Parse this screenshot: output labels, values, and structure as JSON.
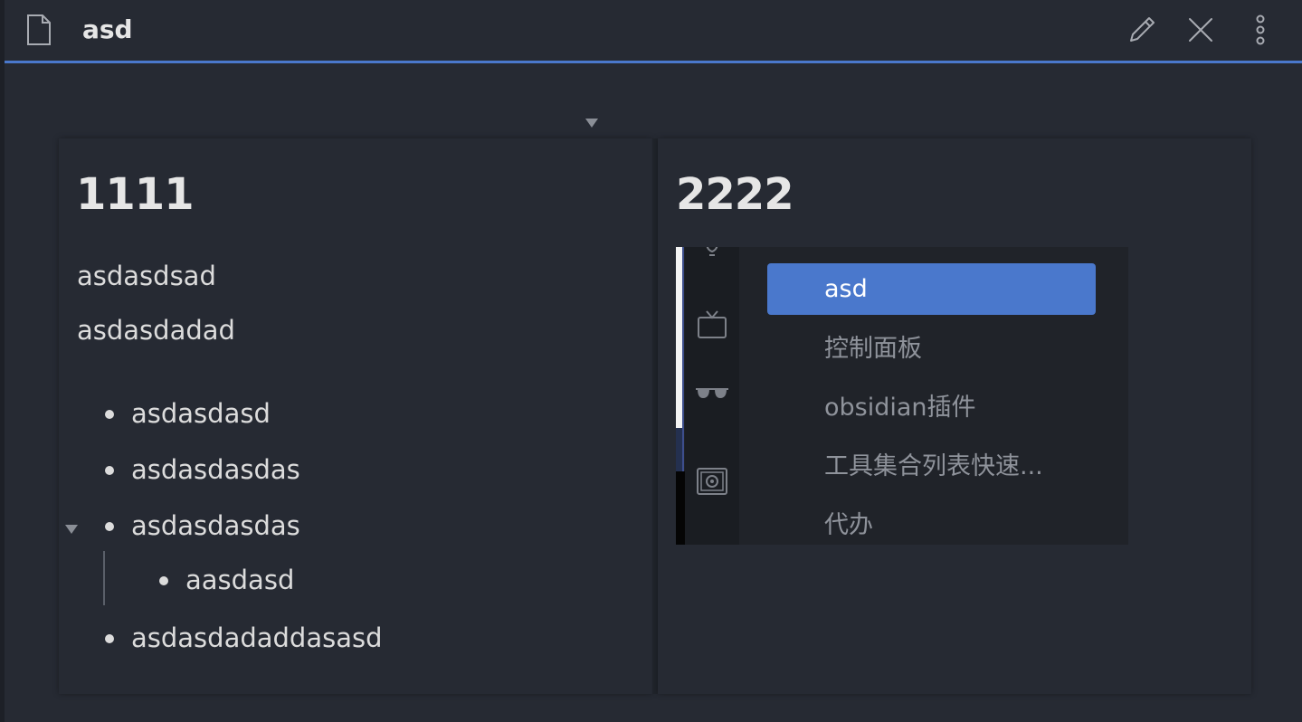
{
  "tab": {
    "title": "asd",
    "icons": {
      "file": "file-icon",
      "edit": "pencil-icon",
      "close": "close-icon",
      "more": "more-vertical-icon"
    }
  },
  "left_column": {
    "heading": "1111",
    "paragraphs": [
      "asdasdsad",
      "asdasdadad"
    ],
    "list": [
      {
        "text": "asdasdasd",
        "level": 0
      },
      {
        "text": "asdasdasdas",
        "level": 0
      },
      {
        "text": "asdasdasdas",
        "level": 0,
        "collapsible": true
      },
      {
        "text": "aasdasd",
        "level": 1
      },
      {
        "text": "asdasdadaddasasd",
        "level": 0
      }
    ]
  },
  "right_column": {
    "heading": "2222",
    "embed": {
      "ribbon_icons": [
        "lightbulb-icon",
        "tv-icon",
        "sunglasses-icon",
        "safe-icon"
      ],
      "items": [
        {
          "label": "asd",
          "active": true
        },
        {
          "label": "控制面板",
          "active": false
        },
        {
          "label": "obsidian插件",
          "active": false
        },
        {
          "label": "工具集合列表快速...",
          "active": false
        },
        {
          "label": "代办",
          "active": false
        }
      ]
    }
  },
  "colors": {
    "background": "#262a33",
    "accent": "#4a78cc",
    "text": "#dcdcdc",
    "muted": "#8f939b"
  }
}
